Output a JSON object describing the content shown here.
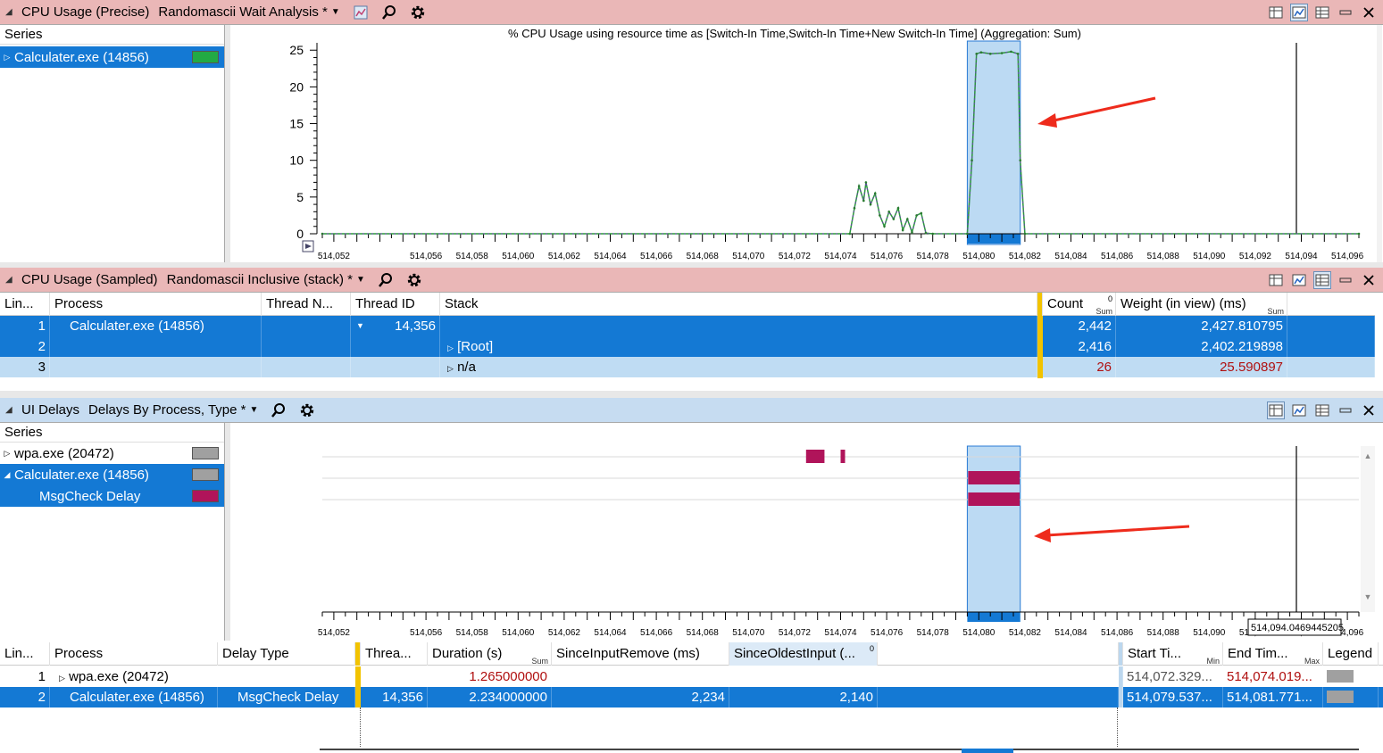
{
  "panel1": {
    "title": "CPU Usage (Precise)",
    "view": "Randomascii Wait Analysis *",
    "series_header": "Series",
    "series": [
      {
        "label": "Calculater.exe (14856)",
        "color": "#22aa44"
      }
    ],
    "chart_title": "% CPU Usage using resource time as [Switch-In Time,Switch-In Time+New Switch-In Time] (Aggregation: Sum)"
  },
  "panel2": {
    "title": "CPU Usage (Sampled)",
    "view": "Randomascii Inclusive (stack) *",
    "columns": [
      "Lin...",
      "Process",
      "Thread N...",
      "Thread ID",
      "Stack",
      "Count",
      "Weight (in view) (ms)"
    ],
    "count_agg": "Sum",
    "weight_agg": "Sum",
    "count_sort_mark": "0",
    "rows": [
      {
        "line": "1",
        "process": "Calculater.exe (14856)",
        "thread_name": "",
        "thread_id": "14,356",
        "stack": "",
        "count": "2,442",
        "weight": "2,427.810795"
      },
      {
        "line": "2",
        "process": "",
        "thread_name": "",
        "thread_id": "",
        "stack": "[Root]",
        "count": "2,416",
        "weight": "2,402.219898"
      },
      {
        "line": "3",
        "process": "",
        "thread_name": "",
        "thread_id": "",
        "stack": "n/a",
        "count": "26",
        "weight": "25.590897"
      }
    ]
  },
  "panel3": {
    "title": "UI Delays",
    "view": "Delays By Process, Type *",
    "series_header": "Series",
    "series": [
      {
        "label": "wpa.exe (20472)",
        "color": "#a0a0a0"
      },
      {
        "label": "Calculater.exe (14856)",
        "color": "#a0a0a0"
      },
      {
        "label": "MsgCheck Delay",
        "color": "#b0145a"
      }
    ],
    "cursor_readout": "514,094.0469445205",
    "columns": [
      "Lin...",
      "Process",
      "Delay Type",
      "Threa...",
      "Duration (s)",
      "SinceInputRemove (ms)",
      "SinceOldestInput (...",
      "Start Ti...",
      "End Tim...",
      "Legend"
    ],
    "duration_agg": "Sum",
    "start_agg": "Min",
    "end_agg": "Max",
    "oldest_sort_mark": "0",
    "rows": [
      {
        "line": "1",
        "process": "wpa.exe (20472)",
        "delay_type": "",
        "thread": "",
        "duration": "1.265000000",
        "since_input_remove": "",
        "since_oldest_input": "",
        "start": "514,072.329...",
        "end": "514,074.019...",
        "legend_color": "#a0a0a0"
      },
      {
        "line": "2",
        "process": "Calculater.exe (14856)",
        "delay_type": "MsgCheck Delay",
        "thread": "14,356",
        "duration": "2.234000000",
        "since_input_remove": "2,234",
        "since_oldest_input": "2,140",
        "start": "514,079.537...",
        "end": "514,081.771...",
        "legend_color": "#a0a0a0"
      }
    ]
  },
  "axis_ticks": [
    "514,052",
    "514,056",
    "514,058",
    "514,060",
    "514,062",
    "514,064",
    "514,066",
    "514,068",
    "514,070",
    "514,072",
    "514,074",
    "514,076",
    "514,078",
    "514,080",
    "514,082",
    "514,084",
    "514,086",
    "514,088",
    "514,090",
    "514,092",
    "514,094",
    "514,096"
  ],
  "chart_data": {
    "type": "line",
    "title": "% CPU Usage using resource time as [Switch-In Time,Switch-In Time+New Switch-In Time] (Aggregation: Sum)",
    "xlabel": "",
    "ylabel": "",
    "ylim": [
      0,
      26
    ],
    "xlim": [
      514051.5,
      514096.5
    ],
    "yticks": [
      0,
      5,
      10,
      15,
      20,
      25
    ],
    "grid": false,
    "series": [
      {
        "name": "Calculater.exe (14856)",
        "x": [
          514051.5,
          514074.4,
          514074.6,
          514074.8,
          514075.0,
          514075.1,
          514075.3,
          514075.5,
          514075.7,
          514075.9,
          514076.1,
          514076.3,
          514076.5,
          514076.7,
          514076.9,
          514077.1,
          514077.3,
          514077.5,
          514077.7,
          514078.0,
          514079.5,
          514079.7,
          514079.9,
          514080.1,
          514080.5,
          514081.0,
          514081.4,
          514081.7,
          514081.8,
          514082.0,
          514096.5
        ],
        "y": [
          0,
          0,
          3.5,
          6.5,
          4.5,
          7.0,
          4.0,
          5.5,
          2.5,
          1.0,
          3.0,
          2.0,
          3.5,
          0.5,
          2.0,
          0.2,
          2.5,
          2.8,
          0.1,
          0,
          0,
          10,
          24.5,
          24.7,
          24.5,
          24.6,
          24.8,
          24.5,
          10,
          0,
          0
        ]
      }
    ],
    "selection": [
      514079.5,
      514081.8
    ]
  },
  "timeline_data": {
    "bars": [
      {
        "row": "wpa.exe (20472)",
        "start": 514072.329,
        "end": 514074.019
      },
      {
        "row": "MsgCheck Delay",
        "start": 514079.537,
        "end": 514081.771
      }
    ]
  }
}
